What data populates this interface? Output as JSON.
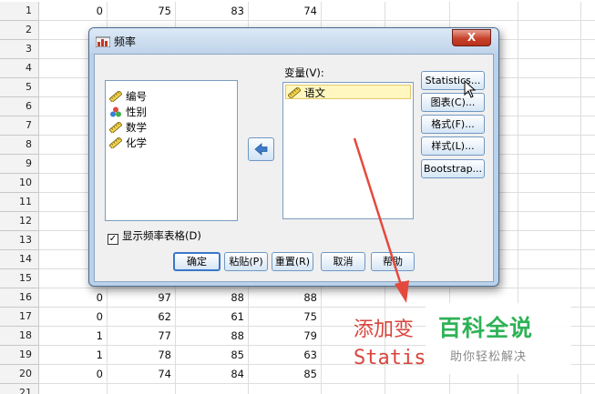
{
  "sheet": {
    "rows": [
      {
        "n": "1",
        "c": [
          "0",
          "75",
          "83",
          "74"
        ]
      },
      {
        "n": "2",
        "c": [
          "",
          "",
          "",
          ""
        ]
      },
      {
        "n": "3",
        "c": [
          "",
          "",
          "",
          ""
        ]
      },
      {
        "n": "4",
        "c": [
          "",
          "",
          "",
          ""
        ]
      },
      {
        "n": "5",
        "c": [
          "",
          "",
          "",
          ""
        ]
      },
      {
        "n": "6",
        "c": [
          "",
          "",
          "",
          ""
        ]
      },
      {
        "n": "7",
        "c": [
          "",
          "",
          "",
          ""
        ]
      },
      {
        "n": "8",
        "c": [
          "",
          "",
          "",
          ""
        ]
      },
      {
        "n": "9",
        "c": [
          "",
          "",
          "",
          ""
        ]
      },
      {
        "n": "10",
        "c": [
          "",
          "",
          "",
          ""
        ]
      },
      {
        "n": "11",
        "c": [
          "",
          "",
          "",
          ""
        ]
      },
      {
        "n": "12",
        "c": [
          "",
          "",
          "",
          ""
        ]
      },
      {
        "n": "13",
        "c": [
          "",
          "",
          "",
          ""
        ]
      },
      {
        "n": "14",
        "c": [
          "",
          "",
          "",
          ""
        ]
      },
      {
        "n": "15",
        "c": [
          "",
          "",
          "",
          ""
        ]
      },
      {
        "n": "16",
        "c": [
          "0",
          "97",
          "88",
          "88"
        ]
      },
      {
        "n": "17",
        "c": [
          "0",
          "62",
          "61",
          "75"
        ]
      },
      {
        "n": "18",
        "c": [
          "1",
          "77",
          "88",
          "79"
        ]
      },
      {
        "n": "19",
        "c": [
          "1",
          "78",
          "85",
          "63"
        ]
      },
      {
        "n": "20",
        "c": [
          "0",
          "74",
          "84",
          "85"
        ]
      },
      {
        "n": "21",
        "c": [
          "",
          "",
          "",
          ""
        ]
      }
    ]
  },
  "dialog": {
    "title": "频率",
    "close_label": "X",
    "source_items": [
      {
        "label": "编号",
        "icon": "ruler-icon"
      },
      {
        "label": "性别",
        "icon": "nominal-icon"
      },
      {
        "label": "数学",
        "icon": "ruler-icon"
      },
      {
        "label": "化学",
        "icon": "ruler-icon"
      }
    ],
    "target_label": "变量(V):",
    "target_items": [
      {
        "label": "语文",
        "icon": "ruler-icon"
      }
    ],
    "side_buttons": [
      "Statistics...",
      "图表(C)...",
      "格式(F)...",
      "样式(L)...",
      "Bootstrap..."
    ],
    "checkbox_label": "显示频率表格(D)",
    "checkbox_checked": true,
    "bottom_buttons": [
      "确定",
      "粘贴(P)",
      "重置(R)",
      "取消",
      "帮助"
    ]
  },
  "annotation": {
    "line1": "添加变",
    "line2": "Statis",
    "color": "#d9453c"
  },
  "watermark": {
    "title": "百科全说",
    "subtitle": "助你轻松解决",
    "color": "#2fb256"
  }
}
